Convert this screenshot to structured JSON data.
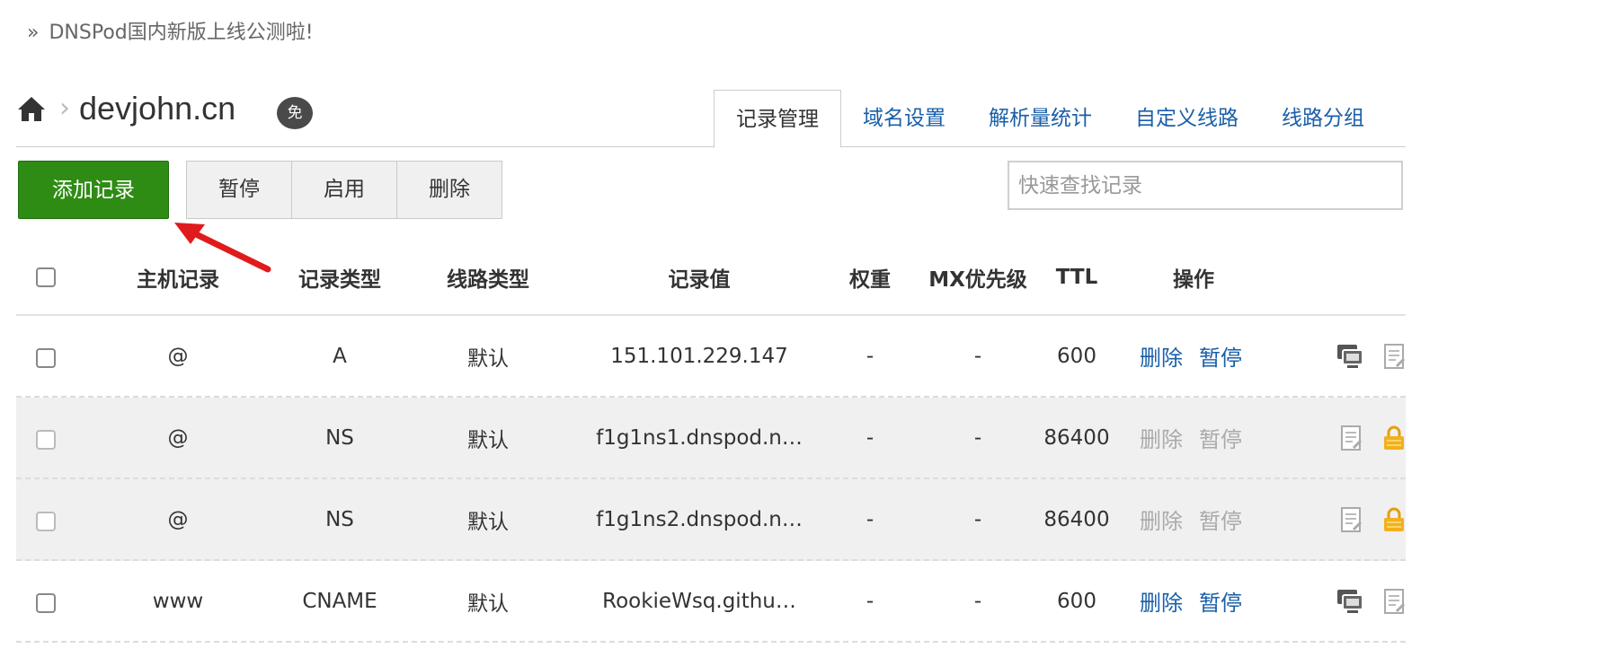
{
  "notice": {
    "prefix": "»",
    "text": "DNSPod国内新版上线公测啦!"
  },
  "breadcrumb": {
    "domain": "devjohn.cn",
    "badge": "免"
  },
  "tabs": [
    {
      "label": "记录管理",
      "active": true
    },
    {
      "label": "域名设置",
      "active": false
    },
    {
      "label": "解析量统计",
      "active": false
    },
    {
      "label": "自定义线路",
      "active": false
    },
    {
      "label": "线路分组",
      "active": false
    }
  ],
  "toolbar": {
    "add_label": "添加记录",
    "pause_label": "暂停",
    "enable_label": "启用",
    "delete_label": "删除",
    "search_placeholder": "快速查找记录"
  },
  "table": {
    "headers": {
      "host": "主机记录",
      "type": "记录类型",
      "line": "线路类型",
      "value": "记录值",
      "weight": "权重",
      "mx": "MX优先级",
      "ttl": "TTL",
      "ops": "操作"
    },
    "rows": [
      {
        "host": "@",
        "type": "A",
        "line": "默认",
        "value": "151.101.229.147",
        "weight": "-",
        "mx": "-",
        "ttl": "600",
        "delete": "删除",
        "pause": "暂停",
        "locked": false
      },
      {
        "host": "@",
        "type": "NS",
        "line": "默认",
        "value": "f1g1ns1.dnspod.n…",
        "weight": "-",
        "mx": "-",
        "ttl": "86400",
        "delete": "删除",
        "pause": "暂停",
        "locked": true
      },
      {
        "host": "@",
        "type": "NS",
        "line": "默认",
        "value": "f1g1ns2.dnspod.n…",
        "weight": "-",
        "mx": "-",
        "ttl": "86400",
        "delete": "删除",
        "pause": "暂停",
        "locked": true
      },
      {
        "host": "www",
        "type": "CNAME",
        "line": "默认",
        "value": "RookieWsq.githu…",
        "weight": "-",
        "mx": "-",
        "ttl": "600",
        "delete": "删除",
        "pause": "暂停",
        "locked": false
      }
    ]
  },
  "colors": {
    "link": "#1a5fa8",
    "add_button": "#2e8c14",
    "arrow": "#e01b1b",
    "lock": "#f2b01e"
  }
}
